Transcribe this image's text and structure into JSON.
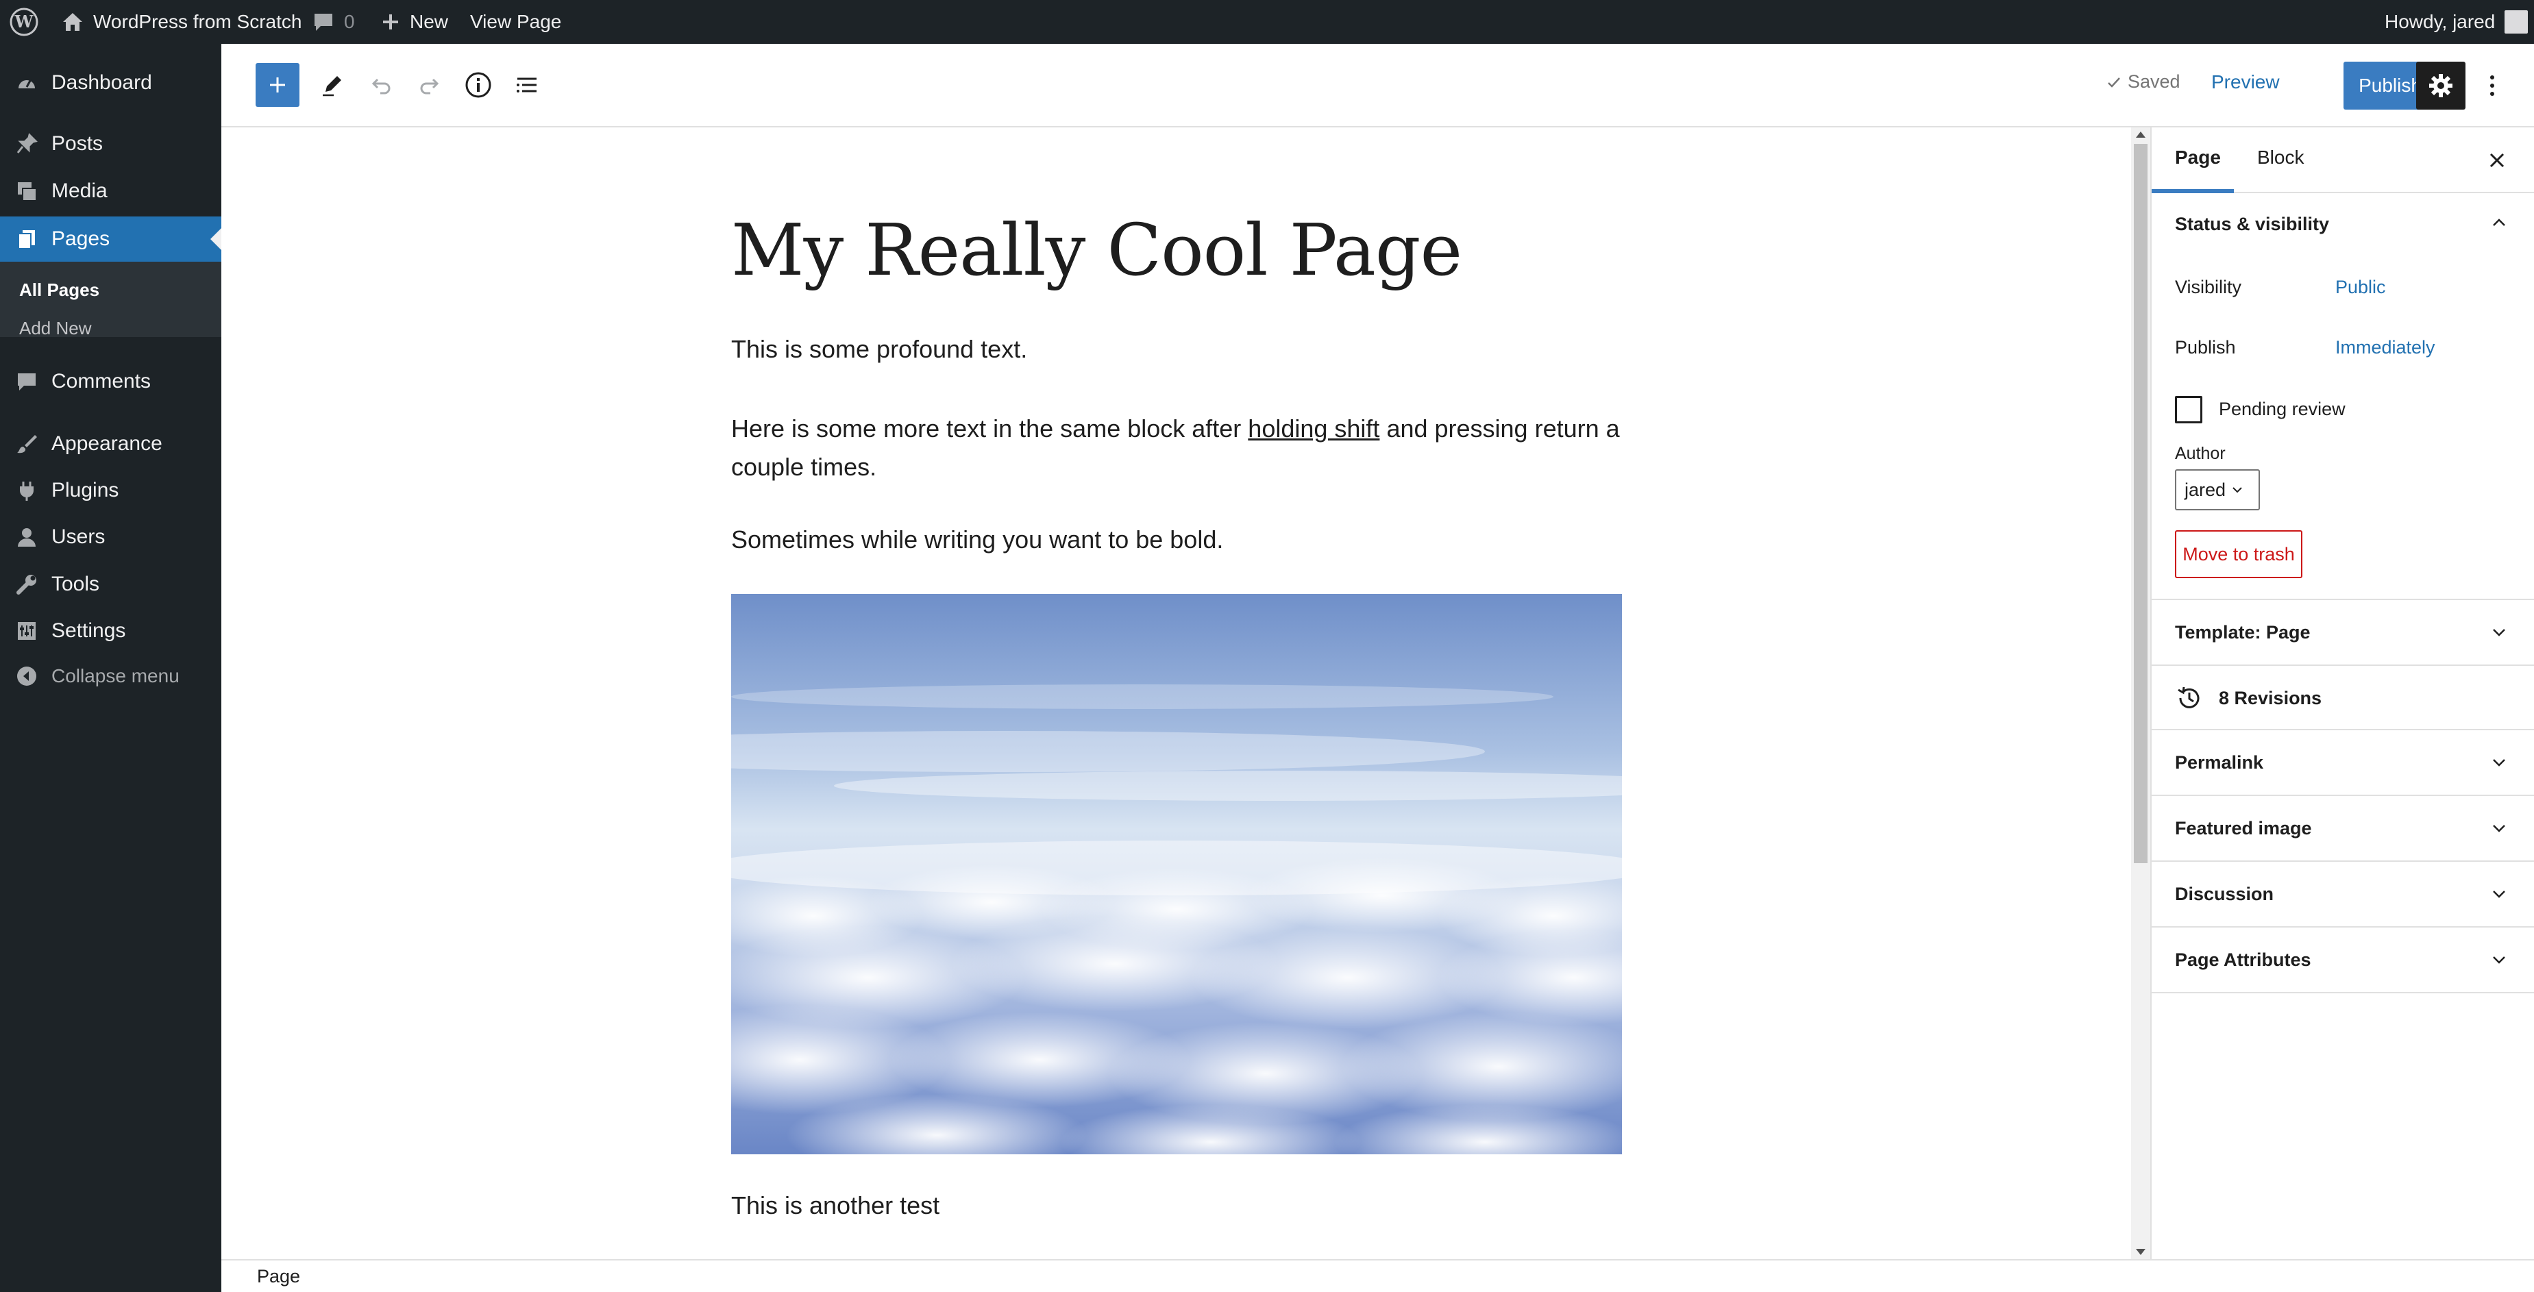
{
  "adminbar": {
    "site_name": "WordPress from Scratch",
    "comments_count": "0",
    "new_label": "New",
    "view_page_label": "View Page",
    "howdy_label": "Howdy, jared"
  },
  "admin_menu": {
    "items": [
      {
        "label": "Dashboard",
        "icon": "dashboard-icon"
      },
      {
        "label": "Posts",
        "icon": "pin-icon"
      },
      {
        "label": "Media",
        "icon": "media-icon"
      },
      {
        "label": "Pages",
        "icon": "pages-icon"
      },
      {
        "label": "Comments",
        "icon": "comment-icon"
      },
      {
        "label": "Appearance",
        "icon": "brush-icon"
      },
      {
        "label": "Plugins",
        "icon": "plugin-icon"
      },
      {
        "label": "Users",
        "icon": "user-icon"
      },
      {
        "label": "Tools",
        "icon": "wrench-icon"
      },
      {
        "label": "Settings",
        "icon": "settings-icon"
      }
    ],
    "submenu": [
      "All Pages",
      "Add New"
    ],
    "collapse_label": "Collapse menu",
    "accent_color": "#2271b1"
  },
  "editor_header": {
    "saved_label": "Saved",
    "preview_label": "Preview",
    "publish_label": "Publish"
  },
  "content": {
    "title": "My Really Cool Page",
    "para1": "This is some profound text.",
    "para2_before": "Here is some more text in the same block after ",
    "para2_link": "holding shift",
    "para2_after": " and pressing return a couple times.",
    "para3": "Sometimes while writing you want to be bold.",
    "para4": "This is another test"
  },
  "footer": {
    "breadcrumb": "Page"
  },
  "sidebar": {
    "tabs": [
      "Page",
      "Block"
    ],
    "status_title": "Status & visibility",
    "visibility_label": "Visibility",
    "visibility_value": "Public",
    "publish_label": "Publish",
    "publish_value": "Immediately",
    "pending_label": "Pending review",
    "author_label": "Author",
    "author_value": "jared",
    "trash_label": "Move to trash",
    "template_title": "Template: Page",
    "revisions_label": "8 Revisions",
    "panels": [
      "Permalink",
      "Featured image",
      "Discussion",
      "Page Attributes"
    ]
  }
}
